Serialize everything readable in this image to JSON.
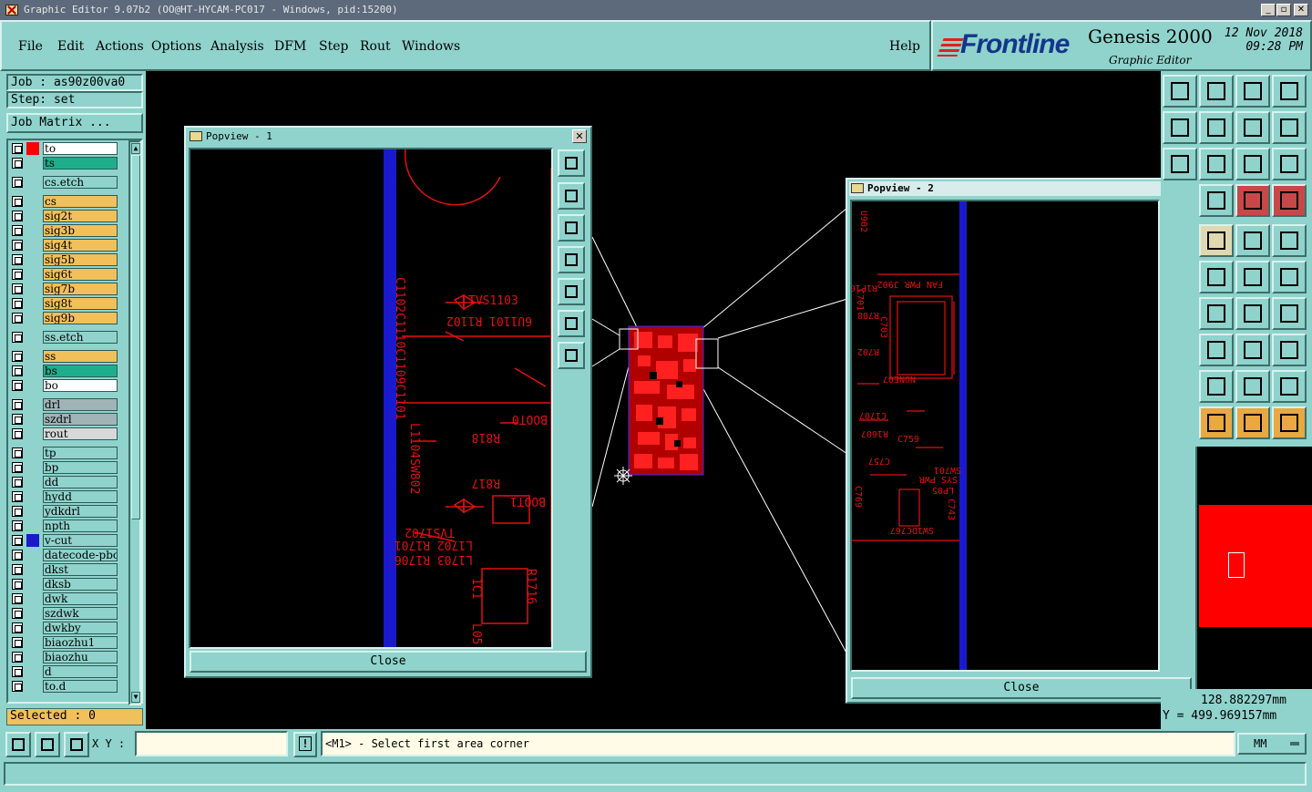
{
  "titlebar": {
    "text": "Graphic Editor 9.07b2 (OO@HT-HYCAM-PC017 - Windows, pid:15200)",
    "min": "_",
    "max": "▫",
    "close": "✕"
  },
  "menu": [
    "File",
    "Edit",
    "Actions",
    "Options",
    "Analysis",
    "DFM",
    "Step",
    "Rout",
    "Windows"
  ],
  "help_label": "Help",
  "logo": {
    "brand": "Frontline",
    "product": "Genesis 2000",
    "subtitle": "Graphic Editor",
    "date": "12 Nov 2018",
    "time": "09:28 PM"
  },
  "job": {
    "job_label": "Job : as90z00va0",
    "step_label": "Step: set",
    "matrix_label": "Job Matrix ..."
  },
  "layers": [
    {
      "name": "to",
      "bg": "#ffffff",
      "swatch": "#ff0000"
    },
    {
      "name": "ts",
      "bg": "#1fae8c",
      "swatch": ""
    },
    {
      "name": "cs.etch",
      "bg": "#8fd3cc",
      "swatch": ""
    },
    {
      "name": "cs",
      "bg": "#f2c05a",
      "swatch": ""
    },
    {
      "name": "sig2t",
      "bg": "#f2c05a",
      "swatch": ""
    },
    {
      "name": "sig3b",
      "bg": "#f2c05a",
      "swatch": ""
    },
    {
      "name": "sig4t",
      "bg": "#f2c05a",
      "swatch": ""
    },
    {
      "name": "sig5b",
      "bg": "#f2c05a",
      "swatch": ""
    },
    {
      "name": "sig6t",
      "bg": "#f2c05a",
      "swatch": ""
    },
    {
      "name": "sig7b",
      "bg": "#f2c05a",
      "swatch": ""
    },
    {
      "name": "sig8t",
      "bg": "#f2c05a",
      "swatch": ""
    },
    {
      "name": "sig9b",
      "bg": "#f2c05a",
      "swatch": ""
    },
    {
      "name": "ss.etch",
      "bg": "#8fd3cc",
      "swatch": ""
    },
    {
      "name": "ss",
      "bg": "#f2c05a",
      "swatch": ""
    },
    {
      "name": "bs",
      "bg": "#1fae8c",
      "swatch": ""
    },
    {
      "name": "bo",
      "bg": "#ffffff",
      "swatch": ""
    },
    {
      "name": "drl",
      "bg": "#a0b4b8",
      "swatch": ""
    },
    {
      "name": "szdrl",
      "bg": "#a0b4b8",
      "swatch": ""
    },
    {
      "name": "rout",
      "bg": "#d8d8d8",
      "swatch": ""
    },
    {
      "name": "tp",
      "bg": "#8fd3cc",
      "swatch": ""
    },
    {
      "name": "bp",
      "bg": "#8fd3cc",
      "swatch": ""
    },
    {
      "name": "dd",
      "bg": "#8fd3cc",
      "swatch": ""
    },
    {
      "name": "hydd",
      "bg": "#8fd3cc",
      "swatch": ""
    },
    {
      "name": "ydkdrl",
      "bg": "#8fd3cc",
      "swatch": ""
    },
    {
      "name": "npth",
      "bg": "#8fd3cc",
      "swatch": ""
    },
    {
      "name": "v-cut",
      "bg": "#8fd3cc",
      "swatch": "#1a1acc"
    },
    {
      "name": "datecode-pbc",
      "bg": "#8fd3cc",
      "swatch": ""
    },
    {
      "name": "dkst",
      "bg": "#8fd3cc",
      "swatch": ""
    },
    {
      "name": "dksb",
      "bg": "#8fd3cc",
      "swatch": ""
    },
    {
      "name": "dwk",
      "bg": "#8fd3cc",
      "swatch": ""
    },
    {
      "name": "szdwk",
      "bg": "#8fd3cc",
      "swatch": ""
    },
    {
      "name": "dwkby",
      "bg": "#8fd3cc",
      "swatch": ""
    },
    {
      "name": "biaozhu1",
      "bg": "#8fd3cc",
      "swatch": ""
    },
    {
      "name": "biaozhu",
      "bg": "#8fd3cc",
      "swatch": ""
    },
    {
      "name": "d",
      "bg": "#8fd3cc",
      "swatch": ""
    },
    {
      "name": "to.d",
      "bg": "#8fd3cc",
      "swatch": ""
    }
  ],
  "selected_label": "Selected : 0",
  "popview1": {
    "title": "Popview - 1",
    "close_label": "Close",
    "close_x": "✕"
  },
  "popview2": {
    "title": "Popview - 2",
    "close_label": "Close",
    "close_x": "✕"
  },
  "popview1_text": [
    "C1102C1110C1109C1101",
    "TVS1103",
    "6U1101 R1102",
    "BOOT0",
    "R818",
    "L1104SW802",
    "R817",
    "BOOT1",
    "TVS1702",
    "L1702 R1701",
    "L1703 R1706",
    "R1716",
    "1C1",
    "L05"
  ],
  "popview2_text": [
    "U902",
    "R1P109",
    "C701",
    "FAN PWR J902",
    "R708",
    "C703",
    "R702",
    "NONE07",
    "C1707",
    "R1607",
    "C759",
    "C757",
    "SW701",
    "SYS PWR",
    "LP05",
    "C743",
    "C769",
    "SW1DC767"
  ],
  "coords": {
    "x": "128.882297mm",
    "y": "Y = 499.969157mm"
  },
  "bottom": {
    "xy_label": "X Y :",
    "prompt": "<M1> - Select first area corner",
    "units": "MM",
    "excl": "!"
  },
  "colors": {
    "panel": "#8fd3cc",
    "layer_red": "#e41010",
    "vcut_blue": "#1a1acc",
    "orange": "#f2c05a"
  }
}
